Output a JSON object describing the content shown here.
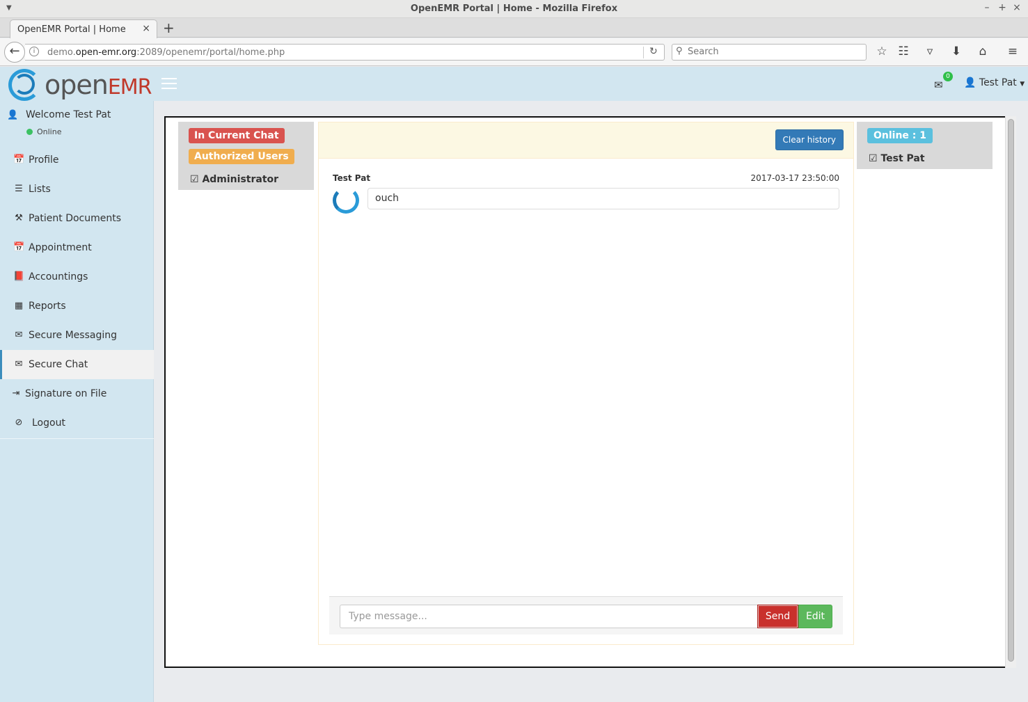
{
  "browser": {
    "window_title": "OpenEMR Portal | Home - Mozilla Firefox",
    "tab_title": "OpenEMR Portal | Home",
    "url_prefix": "demo.",
    "url_host": "open-emr.org",
    "url_rest": ":2089/openemr/portal/home.php",
    "search_placeholder": "Search"
  },
  "header": {
    "logo_text": "open",
    "logo_emr": "EMR",
    "mail_count": "0",
    "user_name": "Test Pat"
  },
  "sidebar": {
    "welcome": "Welcome Test Pat",
    "status": "Online",
    "items": [
      {
        "label": "Profile",
        "icon": "calendar-icon"
      },
      {
        "label": "Lists",
        "icon": "list-icon"
      },
      {
        "label": "Patient Documents",
        "icon": "gavel-icon"
      },
      {
        "label": "Appointment",
        "icon": "calendar-icon"
      },
      {
        "label": "Accountings",
        "icon": "book-icon"
      },
      {
        "label": "Reports",
        "icon": "calendar-grid-icon"
      },
      {
        "label": "Secure Messaging",
        "icon": "envelope-icon"
      },
      {
        "label": "Secure Chat",
        "icon": "envelope-icon"
      },
      {
        "label": "Signature on File",
        "icon": "sign-in-icon"
      },
      {
        "label": "Logout",
        "icon": "ban-icon"
      }
    ],
    "active_item": "Secure Chat"
  },
  "chat": {
    "in_current_chat_label": "In Current Chat",
    "authorized_users_label": "Authorized Users",
    "authorized_users": [
      "Administrator"
    ],
    "clear_history_label": "Clear history",
    "messages": [
      {
        "sender": "Test Pat",
        "time": "2017-03-17 23:50:00",
        "text": "ouch"
      }
    ],
    "input_placeholder": "Type message...",
    "send_label": "Send",
    "edit_label": "Edit",
    "online_label": "Online : 1",
    "online_users": [
      "Test Pat"
    ]
  },
  "colors": {
    "sidebar_bg": "#d2e6f0",
    "primary": "#337ab7",
    "danger": "#d9534f",
    "warning": "#f0ad4e",
    "success": "#5cb85c",
    "info": "#5bc0de"
  }
}
